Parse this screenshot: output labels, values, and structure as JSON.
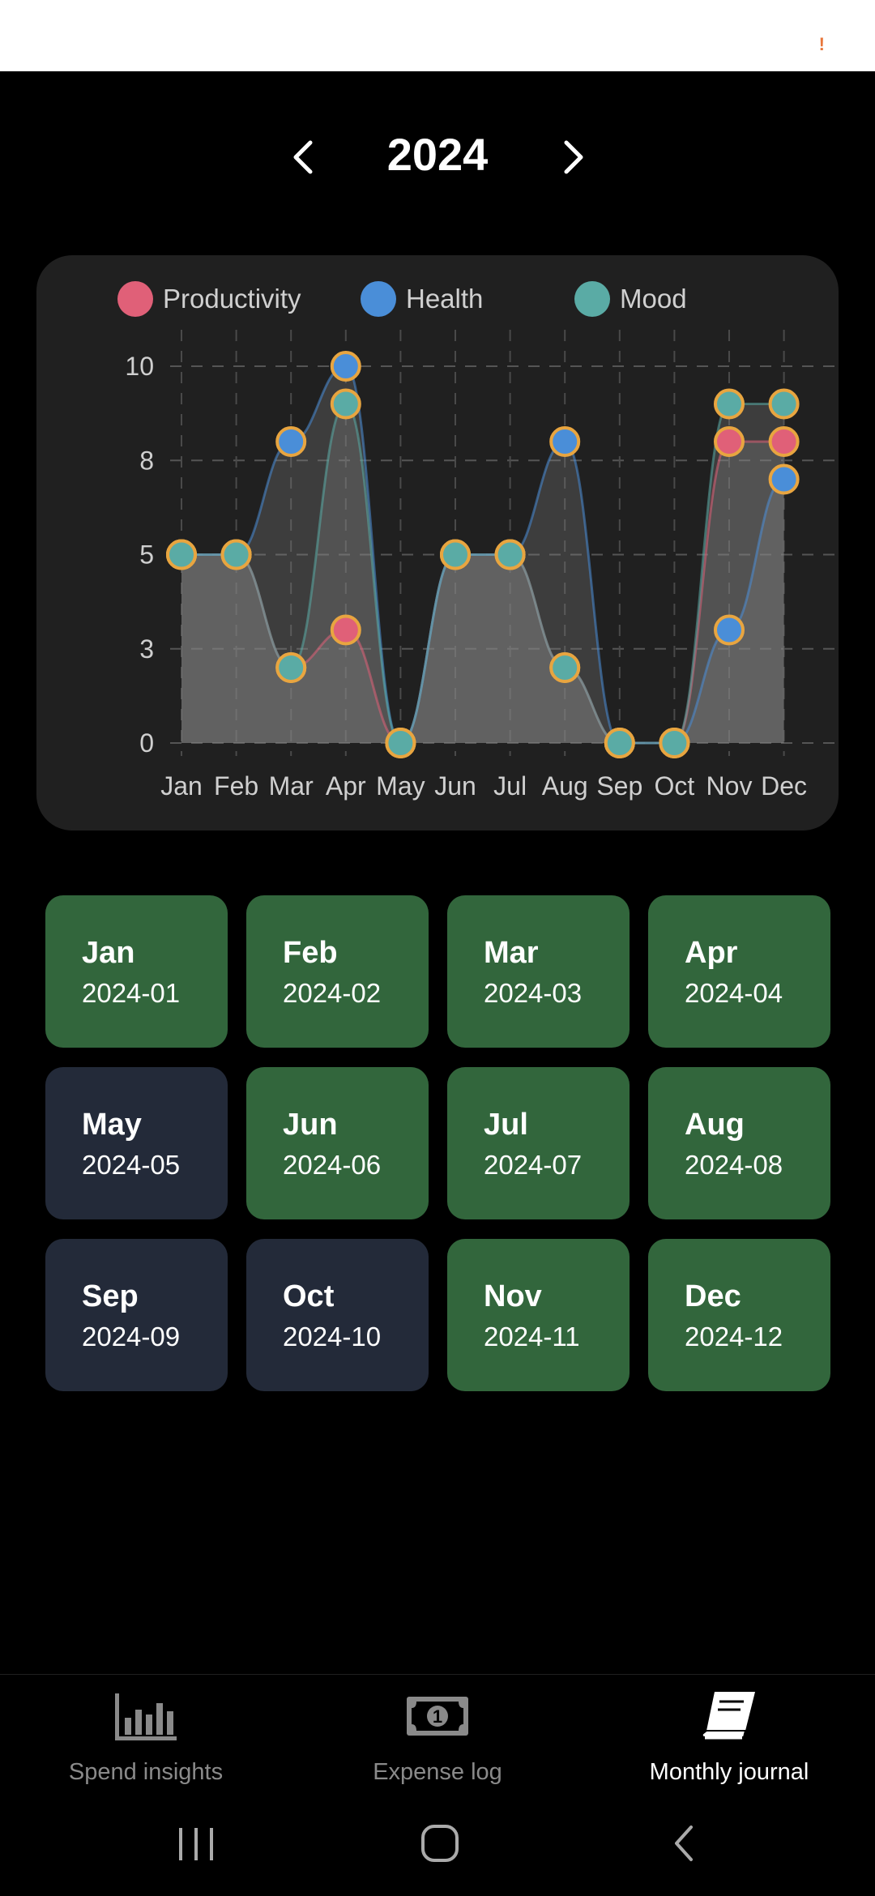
{
  "year_nav": {
    "title": "2024",
    "prev_icon": "chevron-left-icon",
    "next_icon": "chevron-right-icon"
  },
  "legend": [
    {
      "label": "Productivity",
      "color": "#e06078"
    },
    {
      "label": "Health",
      "color": "#4a8ed8"
    },
    {
      "label": "Mood",
      "color": "#5aaba5"
    }
  ],
  "chart_data": {
    "type": "area",
    "categories": [
      "Jan",
      "Feb",
      "Mar",
      "Apr",
      "May",
      "Jun",
      "Jul",
      "Aug",
      "Sep",
      "Oct",
      "Nov",
      "Dec"
    ],
    "y_ticks": [
      "10",
      "8",
      "5",
      "3",
      "0"
    ],
    "ylim": [
      0,
      10
    ],
    "grid": true,
    "legend_position": "top",
    "series": [
      {
        "name": "Productivity",
        "color": "#e06078",
        "values": [
          5,
          5,
          2,
          3,
          0,
          5,
          5,
          2,
          0,
          0,
          8,
          8
        ]
      },
      {
        "name": "Health",
        "color": "#4a8ed8",
        "values": [
          5,
          5,
          8,
          10,
          0,
          5,
          5,
          8,
          0,
          0,
          3,
          7
        ]
      },
      {
        "name": "Mood",
        "color": "#5aaba5",
        "values": [
          5,
          5,
          2,
          9,
          0,
          5,
          5,
          2,
          0,
          0,
          9,
          9
        ]
      }
    ],
    "marker_border_color": "#e8a540"
  },
  "months": [
    {
      "name": "Jan",
      "date": "2024-01",
      "color": "#32663c"
    },
    {
      "name": "Feb",
      "date": "2024-02",
      "color": "#32663c"
    },
    {
      "name": "Mar",
      "date": "2024-03",
      "color": "#32663c"
    },
    {
      "name": "Apr",
      "date": "2024-04",
      "color": "#32663c"
    },
    {
      "name": "May",
      "date": "2024-05",
      "color": "#232a39"
    },
    {
      "name": "Jun",
      "date": "2024-06",
      "color": "#32663c"
    },
    {
      "name": "Jul",
      "date": "2024-07",
      "color": "#32663c"
    },
    {
      "name": "Aug",
      "date": "2024-08",
      "color": "#32663c"
    },
    {
      "name": "Sep",
      "date": "2024-09",
      "color": "#232a39"
    },
    {
      "name": "Oct",
      "date": "2024-10",
      "color": "#232a39"
    },
    {
      "name": "Nov",
      "date": "2024-11",
      "color": "#32663c"
    },
    {
      "name": "Dec",
      "date": "2024-12",
      "color": "#32663c"
    }
  ],
  "bottom_nav": [
    {
      "label": "Spend insights",
      "icon": "bar-chart-icon",
      "active": false
    },
    {
      "label": "Expense log",
      "icon": "banknote-icon",
      "active": false
    },
    {
      "label": "Monthly journal",
      "icon": "book-icon",
      "active": true
    }
  ],
  "banknote_text": "1",
  "status_indicator": "!"
}
